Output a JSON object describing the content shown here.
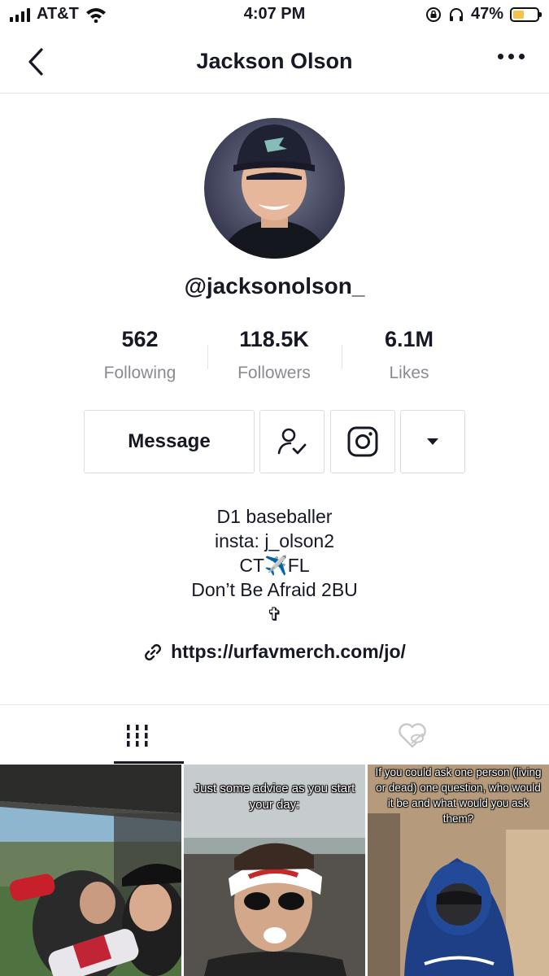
{
  "status_bar": {
    "carrier": "AT&T",
    "time": "4:07 PM",
    "battery": "47%",
    "battery_level": 0.47
  },
  "nav": {
    "title": "Jackson Olson"
  },
  "profile": {
    "username": "@jacksonolson_",
    "stats": [
      {
        "value": "562",
        "label": "Following"
      },
      {
        "value": "118.5K",
        "label": "Followers"
      },
      {
        "value": "6.1M",
        "label": "Likes"
      }
    ],
    "message_label": "Message",
    "bio_lines": [
      "D1 baseballer",
      "insta: j_olson2",
      "CT✈️FL",
      "Don’t Be Afraid 2BU",
      "✞"
    ],
    "link": "https://urfavmerch.com/jo/"
  },
  "videos": [
    {
      "caption": ""
    },
    {
      "caption": "Just some advice as you start your day:"
    },
    {
      "caption": "If you could ask one person (living or dead) one question, who would it be and what would you ask them?"
    }
  ],
  "colors": {
    "text": "#161823",
    "secondary_text": "#8a8b91",
    "border": "#dcdcdd",
    "battery": "#f6c34a"
  }
}
